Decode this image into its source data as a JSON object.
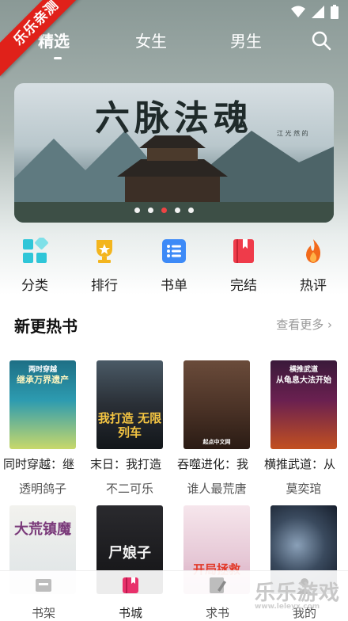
{
  "badge": {
    "text": "乐乐亲测"
  },
  "tabs": [
    {
      "label": "精选",
      "active": true
    },
    {
      "label": "女生",
      "active": false
    },
    {
      "label": "男生",
      "active": false
    }
  ],
  "banner": {
    "title": "六脉法魂",
    "subtitle": "江 光 然 的",
    "dots": 5,
    "active_dot": 3
  },
  "quick_links": [
    {
      "label": "分类",
      "icon": "category-grid-icon",
      "color": "#2fc6d8"
    },
    {
      "label": "排行",
      "icon": "trophy-icon",
      "color": "#f3b51e"
    },
    {
      "label": "书单",
      "icon": "list-icon",
      "color": "#3d8af7"
    },
    {
      "label": "完结",
      "icon": "bookmark-book-icon",
      "color": "#ef3b4a"
    },
    {
      "label": "热评",
      "icon": "flame-icon",
      "color": "#f26a1b"
    }
  ],
  "section": {
    "title": "新更热书",
    "more": "查看更多"
  },
  "books_row1": [
    {
      "title": "同时穿越：继",
      "author": "透明鸽子",
      "cover_text": "继承万界遗产",
      "cover_top": "两时穿越"
    },
    {
      "title": "末日：我打造",
      "author": "不二可乐",
      "cover_text": "我打造 无限列车",
      "cover_top": ""
    },
    {
      "title": "吞噬进化：我",
      "author": "谁人最荒唐",
      "cover_text": "起点中文网",
      "cover_top": ""
    },
    {
      "title": "横推武道：从",
      "author": "莫奕琯",
      "cover_text": "从龟息大法开始",
      "cover_top": "横推武道"
    }
  ],
  "books_row2": [
    {
      "cover_text": "大荒镇魔"
    },
    {
      "cover_text": "尸娘子"
    },
    {
      "cover_text": "开局拯救"
    },
    {
      "cover_text": ""
    }
  ],
  "bottom_nav": [
    {
      "label": "书架",
      "active": false
    },
    {
      "label": "书城",
      "active": true
    },
    {
      "label": "求书",
      "active": false
    },
    {
      "label": "我的",
      "active": false
    }
  ],
  "watermark": {
    "text": "乐乐游戏",
    "url": "www.leleyx.com"
  }
}
